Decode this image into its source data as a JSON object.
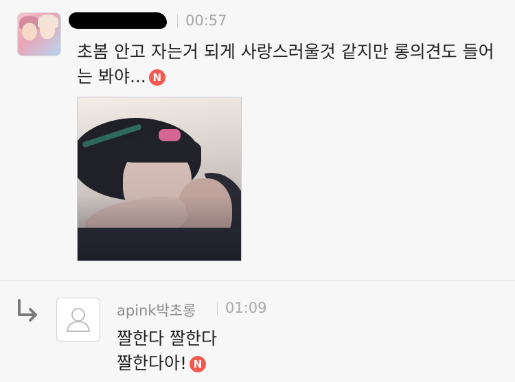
{
  "post": {
    "time": "00:57",
    "body_text": "초봄 안고 자는거 되게 사랑스러울것 같지만 롱의견도 들어는 봐야...",
    "new_badge": "N"
  },
  "reply": {
    "username": "apink박초롱",
    "time": "01:09",
    "line1": "짤한다 짤한다",
    "line2": "짤한다아!",
    "new_badge": "N"
  },
  "colors": {
    "background": "#f7f7f7",
    "badge_red": "#f15a4f",
    "meta_gray": "#a8a8a8"
  },
  "icons": {
    "reply_arrow": "reply-arrow-icon",
    "default_avatar": "default-user-icon",
    "new_badge": "new-badge-icon"
  }
}
